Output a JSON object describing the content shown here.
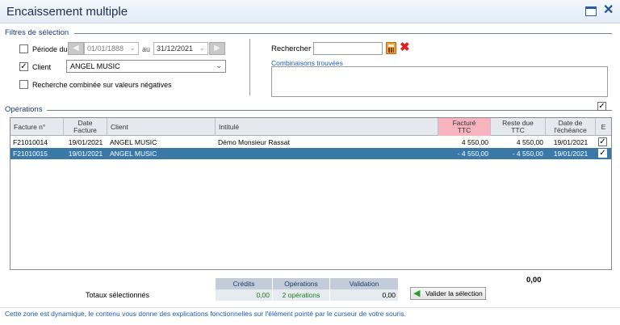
{
  "window": {
    "title": "Encaissement multiple"
  },
  "filters": {
    "section_title": "Filtres de sélection",
    "period_label": "Période du",
    "period_checked": false,
    "date_from": "01/01/1888",
    "date_to_label": "au",
    "date_to": "31/12/2021",
    "client_label": "Client",
    "client_checked": true,
    "client_value": "ANGEL MUSIC",
    "negative_label": "Recherche combinée sur valeurs négatives",
    "negative_checked": false,
    "search_label": "Rechercher",
    "search_value": "",
    "combinations_label": "Combinaisons trouvées"
  },
  "operations": {
    "section_title": "Opérations",
    "columns": {
      "facture": "Facture n°",
      "date": "Date Facture",
      "client": "Client",
      "intitule": "Intitulé",
      "facture_ttc": "Facturé TTC",
      "reste": "Reste due TTC",
      "echeance": "Date de l'échéance",
      "e": "E"
    },
    "rows": [
      {
        "facture": "F21010014",
        "date": "19/01/2021",
        "client": "ANGEL MUSIC",
        "intitule": "Démo Monsieur Rassat",
        "facture_ttc": "4 550,00",
        "reste": "4 550,00",
        "echeance": "19/01/2021",
        "checked": true,
        "selected": false
      },
      {
        "facture": "F21010015",
        "date": "19/01/2021",
        "client": "ANGEL MUSIC",
        "intitule": "",
        "facture_ttc": "- 4 550,00",
        "reste": "- 4 550,00",
        "echeance": "19/01/2021",
        "checked": true,
        "selected": true
      }
    ]
  },
  "totals": {
    "label": "Totaux sélectionnés",
    "credits_header": "Crédits",
    "credits_value": "0,00",
    "operations_header": "Opérations",
    "operations_value": "2 opérations",
    "validation_header": "Validation",
    "validation_value": "0,00",
    "grand_total": "0,00",
    "validate_button": "Valider la sélection"
  },
  "status_text": "Cette zone est dynamique, le contenu vous donne des explications fonctionnelles sur l'élément pointé par le curseur de votre souris.",
  "colors": {
    "selected_row": "#3a78a8",
    "facture_header": "#f7b4bf",
    "accent_text": "#1b5fb6"
  }
}
